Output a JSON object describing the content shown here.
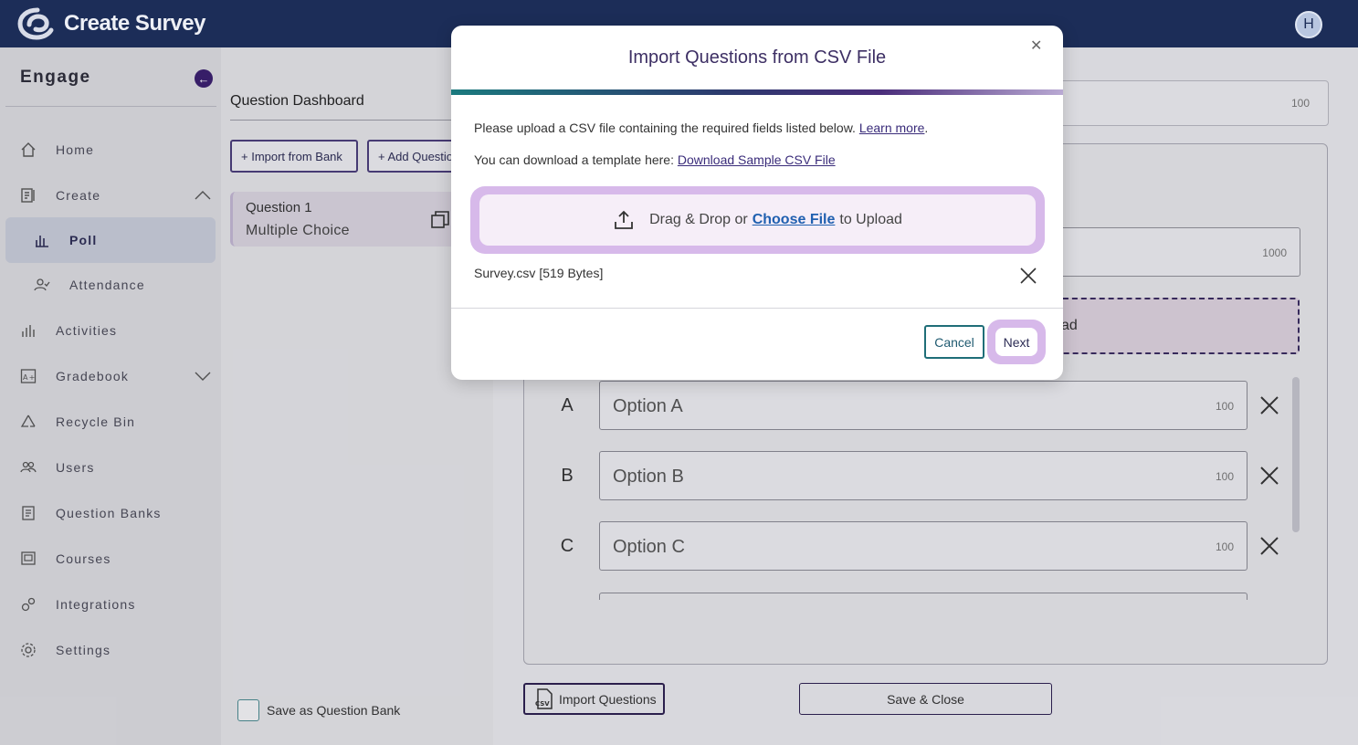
{
  "app": {
    "title": "Create Survey",
    "avatar_initial": "H"
  },
  "sidebar": {
    "heading": "Engage",
    "items": [
      {
        "label": "Home",
        "icon": "home-icon"
      },
      {
        "label": "Create",
        "icon": "create-icon",
        "expanded": true
      },
      {
        "label": "Poll",
        "icon": "poll-icon",
        "active": true
      },
      {
        "label": "Attendance",
        "icon": "attendance-icon"
      },
      {
        "label": "Activities",
        "icon": "activities-icon"
      },
      {
        "label": "Gradebook",
        "icon": "gradebook-icon",
        "expanded": false
      },
      {
        "label": "Recycle Bin",
        "icon": "recycle-icon"
      },
      {
        "label": "Users",
        "icon": "users-icon"
      },
      {
        "label": "Question Banks",
        "icon": "question-banks-icon"
      },
      {
        "label": "Courses",
        "icon": "courses-icon"
      },
      {
        "label": "Integrations",
        "icon": "integrations-icon"
      },
      {
        "label": "Settings",
        "icon": "settings-icon"
      }
    ]
  },
  "dashboard": {
    "title": "Question Dashboard",
    "import_bank_label": "+ Import from Bank",
    "add_question_label": "+ Add Question",
    "question": {
      "title": "Question 1",
      "type": "Multiple Choice"
    },
    "save_bank_label": "Save as Question Bank"
  },
  "editor": {
    "title_count": "100",
    "question_count": "1000",
    "image_upload_partial": "ad",
    "options": [
      {
        "letter": "A",
        "text": "Option A",
        "count": "100"
      },
      {
        "letter": "B",
        "text": "Option B",
        "count": "100"
      },
      {
        "letter": "C",
        "text": "Option C",
        "count": "100"
      }
    ],
    "import_questions_label": "Import Questions",
    "save_close_label": "Save & Close"
  },
  "modal": {
    "title": "Import Questions from CSV File",
    "line1": "Please upload a CSV file containing the required fields listed below.",
    "learn_more": "Learn more",
    "line1_end": ".",
    "line2": "You can download a template here:",
    "download_link": "Download Sample CSV File",
    "drop_prefix": "Drag & Drop or",
    "choose_file": "Choose File",
    "drop_suffix": "to Upload",
    "file_name": "Survey.csv [519 Bytes]",
    "cancel_label": "Cancel",
    "next_label": "Next"
  },
  "colors": {
    "topbar": "#1c2d58",
    "accent": "#3a1f6e",
    "teal": "#1f6e78",
    "highlight": "#d7b9ea"
  }
}
